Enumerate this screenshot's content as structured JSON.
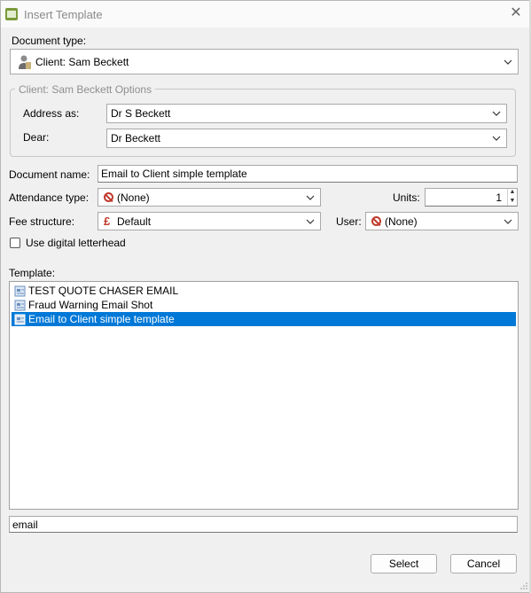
{
  "window": {
    "title": "Insert Template"
  },
  "document_type": {
    "label": "Document type:",
    "value": "Client: Sam Beckett"
  },
  "options_group": {
    "legend": "Client: Sam Beckett Options",
    "address_as": {
      "label": "Address as:",
      "value": "Dr S Beckett"
    },
    "dear": {
      "label": "Dear:",
      "value": "Dr Beckett"
    }
  },
  "document_name": {
    "label": "Document name:",
    "value": "Email to Client simple template"
  },
  "attendance_type": {
    "label": "Attendance type:",
    "value": "(None)"
  },
  "units": {
    "label": "Units:",
    "value": "1"
  },
  "fee_structure": {
    "label": "Fee structure:",
    "value": "Default"
  },
  "user": {
    "label": "User:",
    "value": "(None)"
  },
  "digital_letterhead": {
    "label": "Use digital letterhead",
    "checked": false
  },
  "template": {
    "label": "Template:",
    "items": [
      {
        "label": "TEST QUOTE CHASER EMAIL",
        "selected": false
      },
      {
        "label": "Fraud Warning Email Shot",
        "selected": false
      },
      {
        "label": "Email to Client simple template",
        "selected": true
      }
    ]
  },
  "filter": {
    "value": "email"
  },
  "buttons": {
    "select": "Select",
    "cancel": "Cancel"
  },
  "colors": {
    "selection": "#0078d7",
    "background": "#f0f0f0",
    "accent_red": "#c0392b"
  },
  "icons": {
    "app": "app-icon",
    "close": "close-icon",
    "client": "person-icon",
    "template_doc": "document-icon",
    "none": "no-entry-icon",
    "fee": "pound-icon"
  }
}
